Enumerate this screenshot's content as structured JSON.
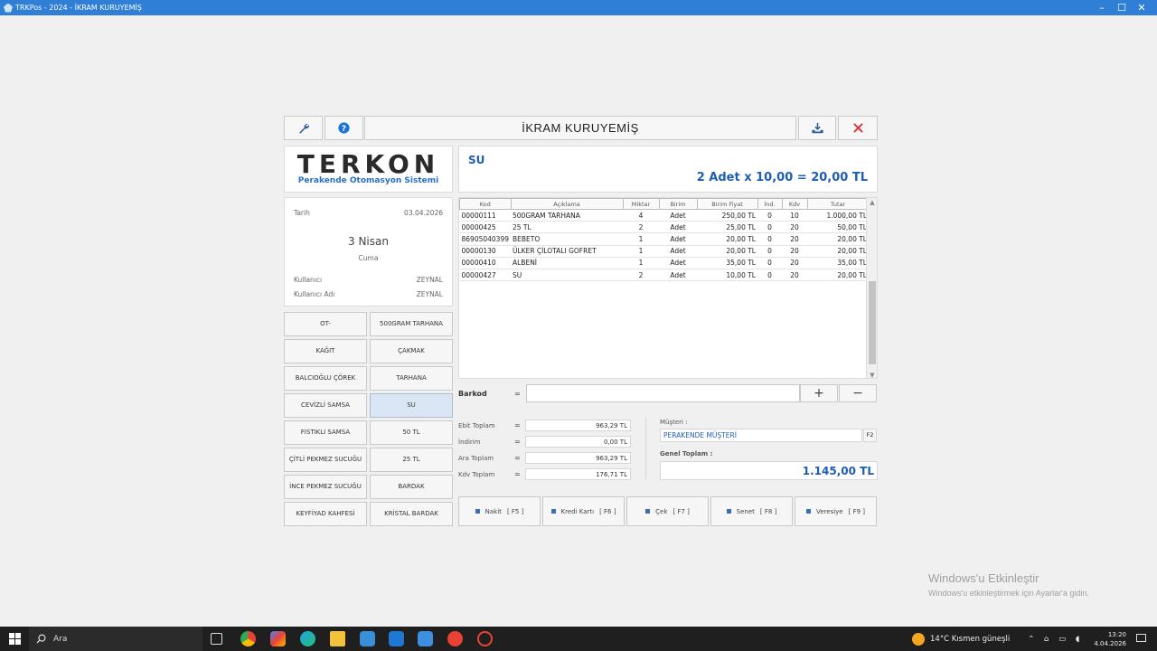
{
  "window": {
    "title": "TRKPos - 2024 - İKRAM KURUYEMİŞ",
    "min": "–",
    "max": "☐",
    "close": "✕"
  },
  "app": {
    "title": "İKRAM KURUYEMİŞ"
  },
  "logo": {
    "brand": "TERKON",
    "subtitle": "Perakende Otomasyon Sistemi"
  },
  "product": {
    "name": "SU",
    "total": "2 Adet x 10,00 = 20,00 TL"
  },
  "info": {
    "date_label": "Tarih",
    "date_value": "03.04.2026",
    "day": "3 Nisan",
    "weekday": "Cuma",
    "user_label": "Kullanıcı",
    "user_value": "ZEYNAL",
    "username_label": "Kullanıcı Adı",
    "username_value": "ZEYNAL"
  },
  "quick_buttons": [
    "OT-",
    "500GRAM TARHANA",
    "KAĞIT",
    "ÇAKMAK",
    "BALCIOĞLU ÇÖREK",
    "TARHANA",
    "CEVİZLİ SAMSA",
    "SU",
    "FISTIKLI SAMSA",
    "50 TL",
    "ÇİTLİ PEKMEZ SUCUĞU",
    "25 TL",
    "İNCE PEKMEZ SUCUĞU",
    "BARDAK",
    "KEYFİYAD KAHFESİ",
    "KRİSTAL BARDAK"
  ],
  "grid": {
    "headers": [
      "Kod",
      "Açıklama",
      "Miktar",
      "Birim",
      "Birim Fiyat",
      "İnd.",
      "Kdv",
      "Tutar"
    ],
    "rows": [
      [
        "00000111",
        "500GRAM TARHANA",
        "4",
        "Adet",
        "250,00 TL",
        "0",
        "10",
        "1.000,00 TL"
      ],
      [
        "00000425",
        "25 TL",
        "2",
        "Adet",
        "25,00 TL",
        "0",
        "20",
        "50,00 TL"
      ],
      [
        "86905040399",
        "BEBETO",
        "1",
        "Adet",
        "20,00 TL",
        "0",
        "20",
        "20,00 TL"
      ],
      [
        "00000130",
        "ÜLKER ÇİLOTALI GOFRET",
        "1",
        "Adet",
        "20,00 TL",
        "0",
        "20",
        "20,00 TL"
      ],
      [
        "00000410",
        "ALBENİ",
        "1",
        "Adet",
        "35,00 TL",
        "0",
        "20",
        "35,00 TL"
      ],
      [
        "00000427",
        "SU",
        "2",
        "Adet",
        "10,00 TL",
        "0",
        "20",
        "20,00 TL"
      ]
    ]
  },
  "barcode": {
    "label": "Barkod",
    "eq": "=",
    "value": "",
    "plus": "+",
    "minus": "−"
  },
  "totals": {
    "net_label": "Ebit Toplam",
    "net_value": "963,29 TL",
    "discount_label": "İndirim",
    "discount_value": "0,00 TL",
    "subtotal_label": "Ara Toplam",
    "subtotal_value": "963,29 TL",
    "vat_label": "Kdv Toplam",
    "vat_value": "176,71 TL",
    "eq": "="
  },
  "customer": {
    "label": "Müşteri :",
    "value": "PERAKENDE MÜŞTERİ",
    "key": "F2"
  },
  "grand_total": {
    "label": "Genel Toplam :",
    "value": "1.145,00 TL"
  },
  "payments": [
    {
      "label": "Nakit",
      "key": "[ F5 ]"
    },
    {
      "label": "Kredi Kartı",
      "key": "[ F6 ]"
    },
    {
      "label": "Çek",
      "key": "[ F7 ]"
    },
    {
      "label": "Senet",
      "key": "[ F8 ]"
    },
    {
      "label": "Veresiye",
      "key": "[ F9 ]"
    }
  ],
  "watermark": {
    "line1": "Windows'u Etkinleştir",
    "line2": "Windows'u etkinleştirmek için Ayarlar'a gidin."
  },
  "taskbar": {
    "search": "Ara",
    "weather": "14°C  Kısmen güneşli",
    "time": "13:20",
    "date": "4.04.2026"
  },
  "colors": {
    "accent": "#1f5db5",
    "titlebar": "#2f7fd6",
    "close": "#d93434"
  }
}
